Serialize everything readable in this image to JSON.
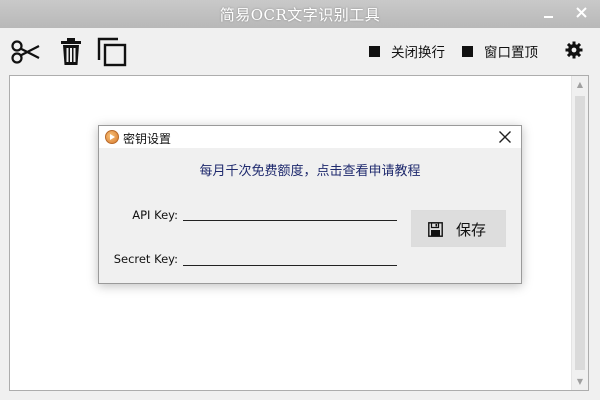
{
  "window": {
    "title": "简易OCR文字识别工具",
    "controls": [
      "minimize-icon",
      "close-icon"
    ]
  },
  "toolbar": {
    "buttons": [
      "scissors-icon",
      "trash-icon",
      "copy-icon"
    ],
    "toggle_wrap_label": "关闭换行",
    "toggle_top_label": "窗口置顶",
    "settings_icon": "gear-icon"
  },
  "main": {
    "text_value": ""
  },
  "dialog": {
    "title": "密钥设置",
    "link_text": "每月千次免费额度，点击查看申请教程",
    "api_key_label": "API Key:",
    "api_key_value": "",
    "secret_key_label": "Secret Key:",
    "secret_key_value": "",
    "save_label": "保存",
    "colors": {
      "link": "#1f2a6e"
    }
  }
}
